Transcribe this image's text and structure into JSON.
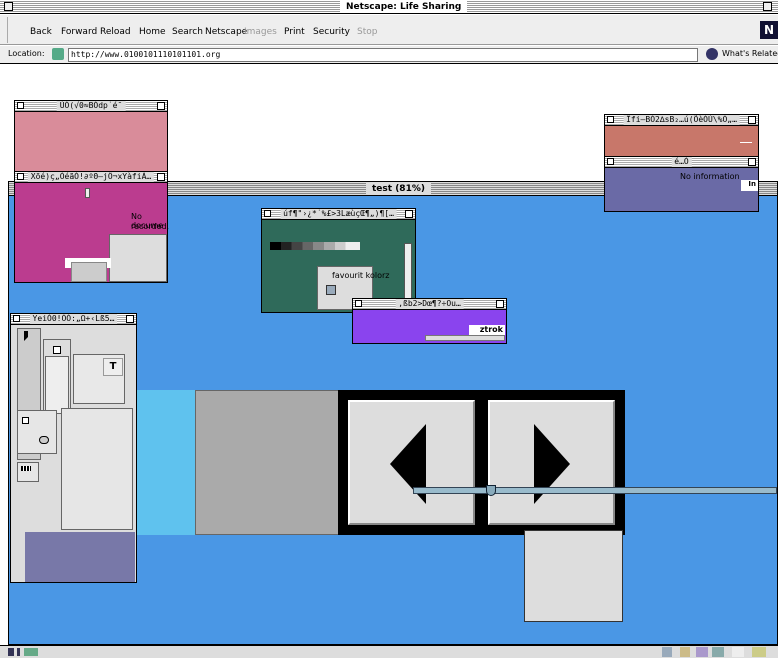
{
  "window": {
    "title": "Netscape: Life Sharing"
  },
  "toolbar": {
    "back": "Back",
    "forward": "Forward",
    "reload": "Reload",
    "home": "Home",
    "search": "Search",
    "netscape": "Netscape",
    "images": "Images",
    "print": "Print",
    "security": "Security",
    "stop": "Stop",
    "logo": "N"
  },
  "location": {
    "label": "Location:",
    "url": "http://www.0100101110101101.org",
    "whats_related": "What's Related"
  },
  "inner_window": {
    "title": "test (81%)"
  },
  "palettes": {
    "pink": {
      "title": "ÙÓ(√0≈BÒdp˙é¯"
    },
    "magenta": {
      "title": "Xõé)ç„ÒéãÒ!∂ºΘ–jÖ¬xYàfiÀ…",
      "text1": "No docume",
      "text2": "recorded."
    },
    "green": {
      "title": "úf¶\"›¿*˙%£>3LæùçŒ¶„)¶[…",
      "label": "favourit kolorz"
    },
    "purple": {
      "title": ",ßb2>Dœ¶?÷Ou…",
      "label": "ztrok"
    },
    "salmon": {
      "title": "Îfi–BÒ2∆sB₂…ú(ÕèÒÙ\\%Ò„…"
    },
    "navy": {
      "title": "é…Ò",
      "text": "No information",
      "text2": "In"
    },
    "tools": {
      "title": "YeiÒ0!ÒÒ:„Ω+‹Lß5…",
      "t_label": "T"
    }
  },
  "colors": {
    "desktop_blue": "#4a97e5",
    "pink": "#d98c9a",
    "magenta": "#bb3c8f",
    "green": "#2f6a5a",
    "purple": "#8a44ee",
    "salmon": "#c8776a",
    "navy": "#6a6aa6",
    "cyan": "#5fc2ee"
  }
}
